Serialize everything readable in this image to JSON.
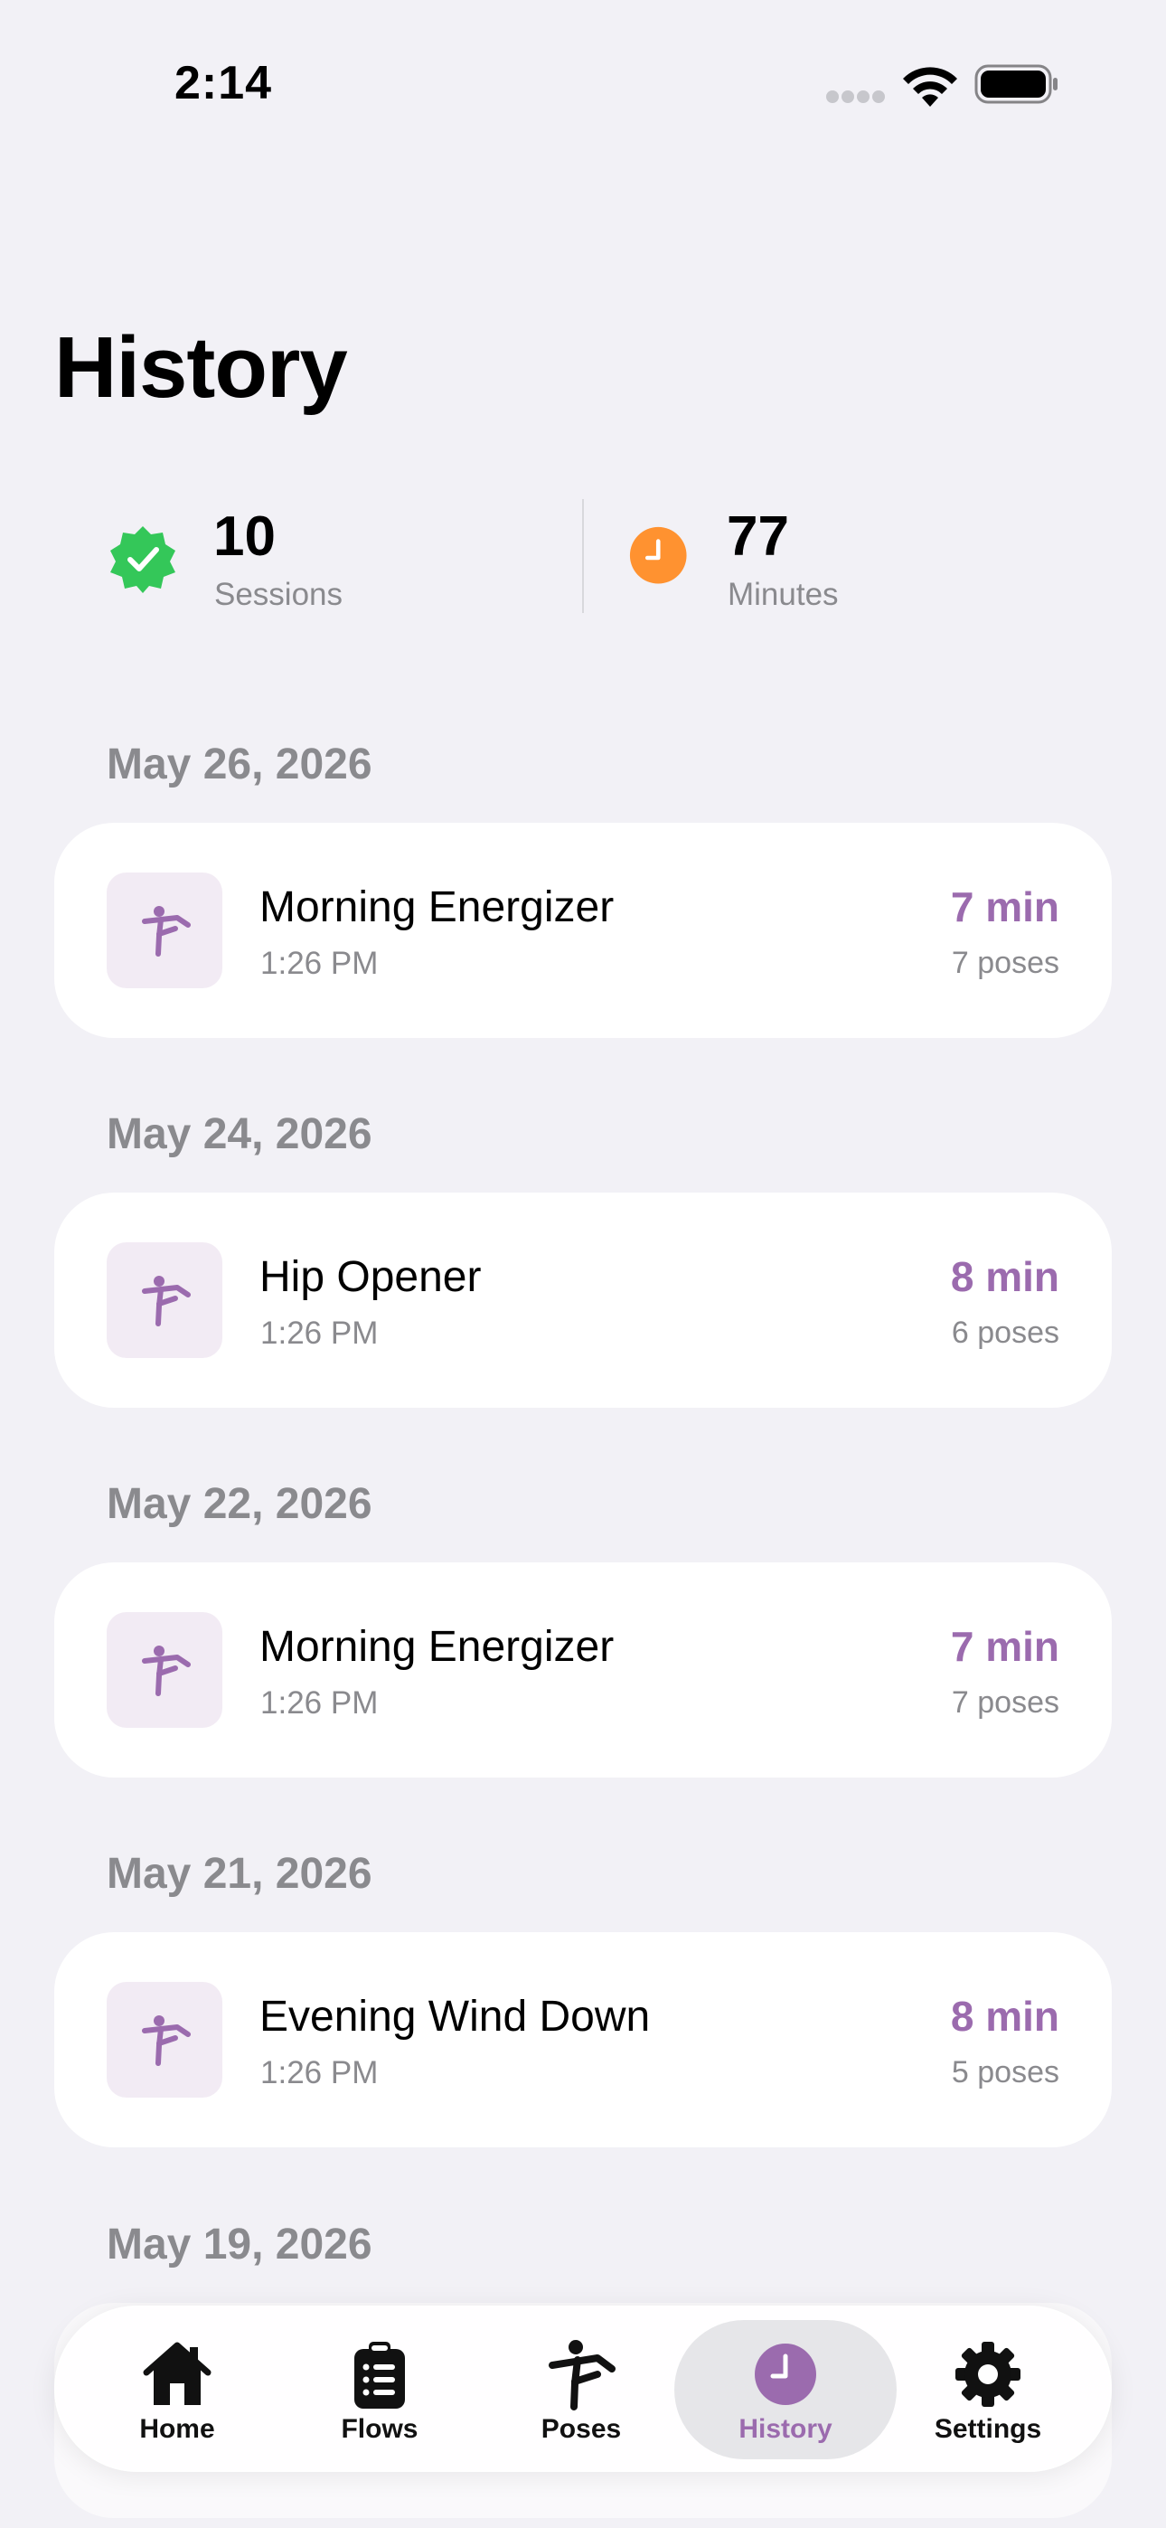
{
  "status_bar": {
    "time": "2:14"
  },
  "page": {
    "title": "History"
  },
  "stats": {
    "sessions": {
      "value": "10",
      "label": "Sessions"
    },
    "minutes": {
      "value": "77",
      "label": "Minutes"
    }
  },
  "history": [
    {
      "date": "May 26, 2026",
      "title": "Morning Energizer",
      "time": "1:26 PM",
      "duration": "7 min",
      "poses": "7 poses"
    },
    {
      "date": "May 24, 2026",
      "title": "Hip Opener",
      "time": "1:26 PM",
      "duration": "8 min",
      "poses": "6 poses"
    },
    {
      "date": "May 22, 2026",
      "title": "Morning Energizer",
      "time": "1:26 PM",
      "duration": "7 min",
      "poses": "7 poses"
    },
    {
      "date": "May 21, 2026",
      "title": "Evening Wind Down",
      "time": "1:26 PM",
      "duration": "8 min",
      "poses": "5 poses"
    }
  ],
  "partial_entry": {
    "date": "May 19, 2026"
  },
  "tab_bar": {
    "tabs": [
      {
        "label": "Home",
        "icon": "house-icon"
      },
      {
        "label": "Flows",
        "icon": "clipboard-list-icon"
      },
      {
        "label": "Poses",
        "icon": "yoga-pose-icon"
      },
      {
        "label": "History",
        "icon": "clock-icon",
        "active": true
      },
      {
        "label": "Settings",
        "icon": "gear-icon"
      }
    ]
  },
  "colors": {
    "accent": "#9B6BAE",
    "background": "#F2F1F6",
    "sessions_badge": "#34C759",
    "minutes_badge": "#FF9230",
    "secondary_text": "#8A8A8E"
  }
}
